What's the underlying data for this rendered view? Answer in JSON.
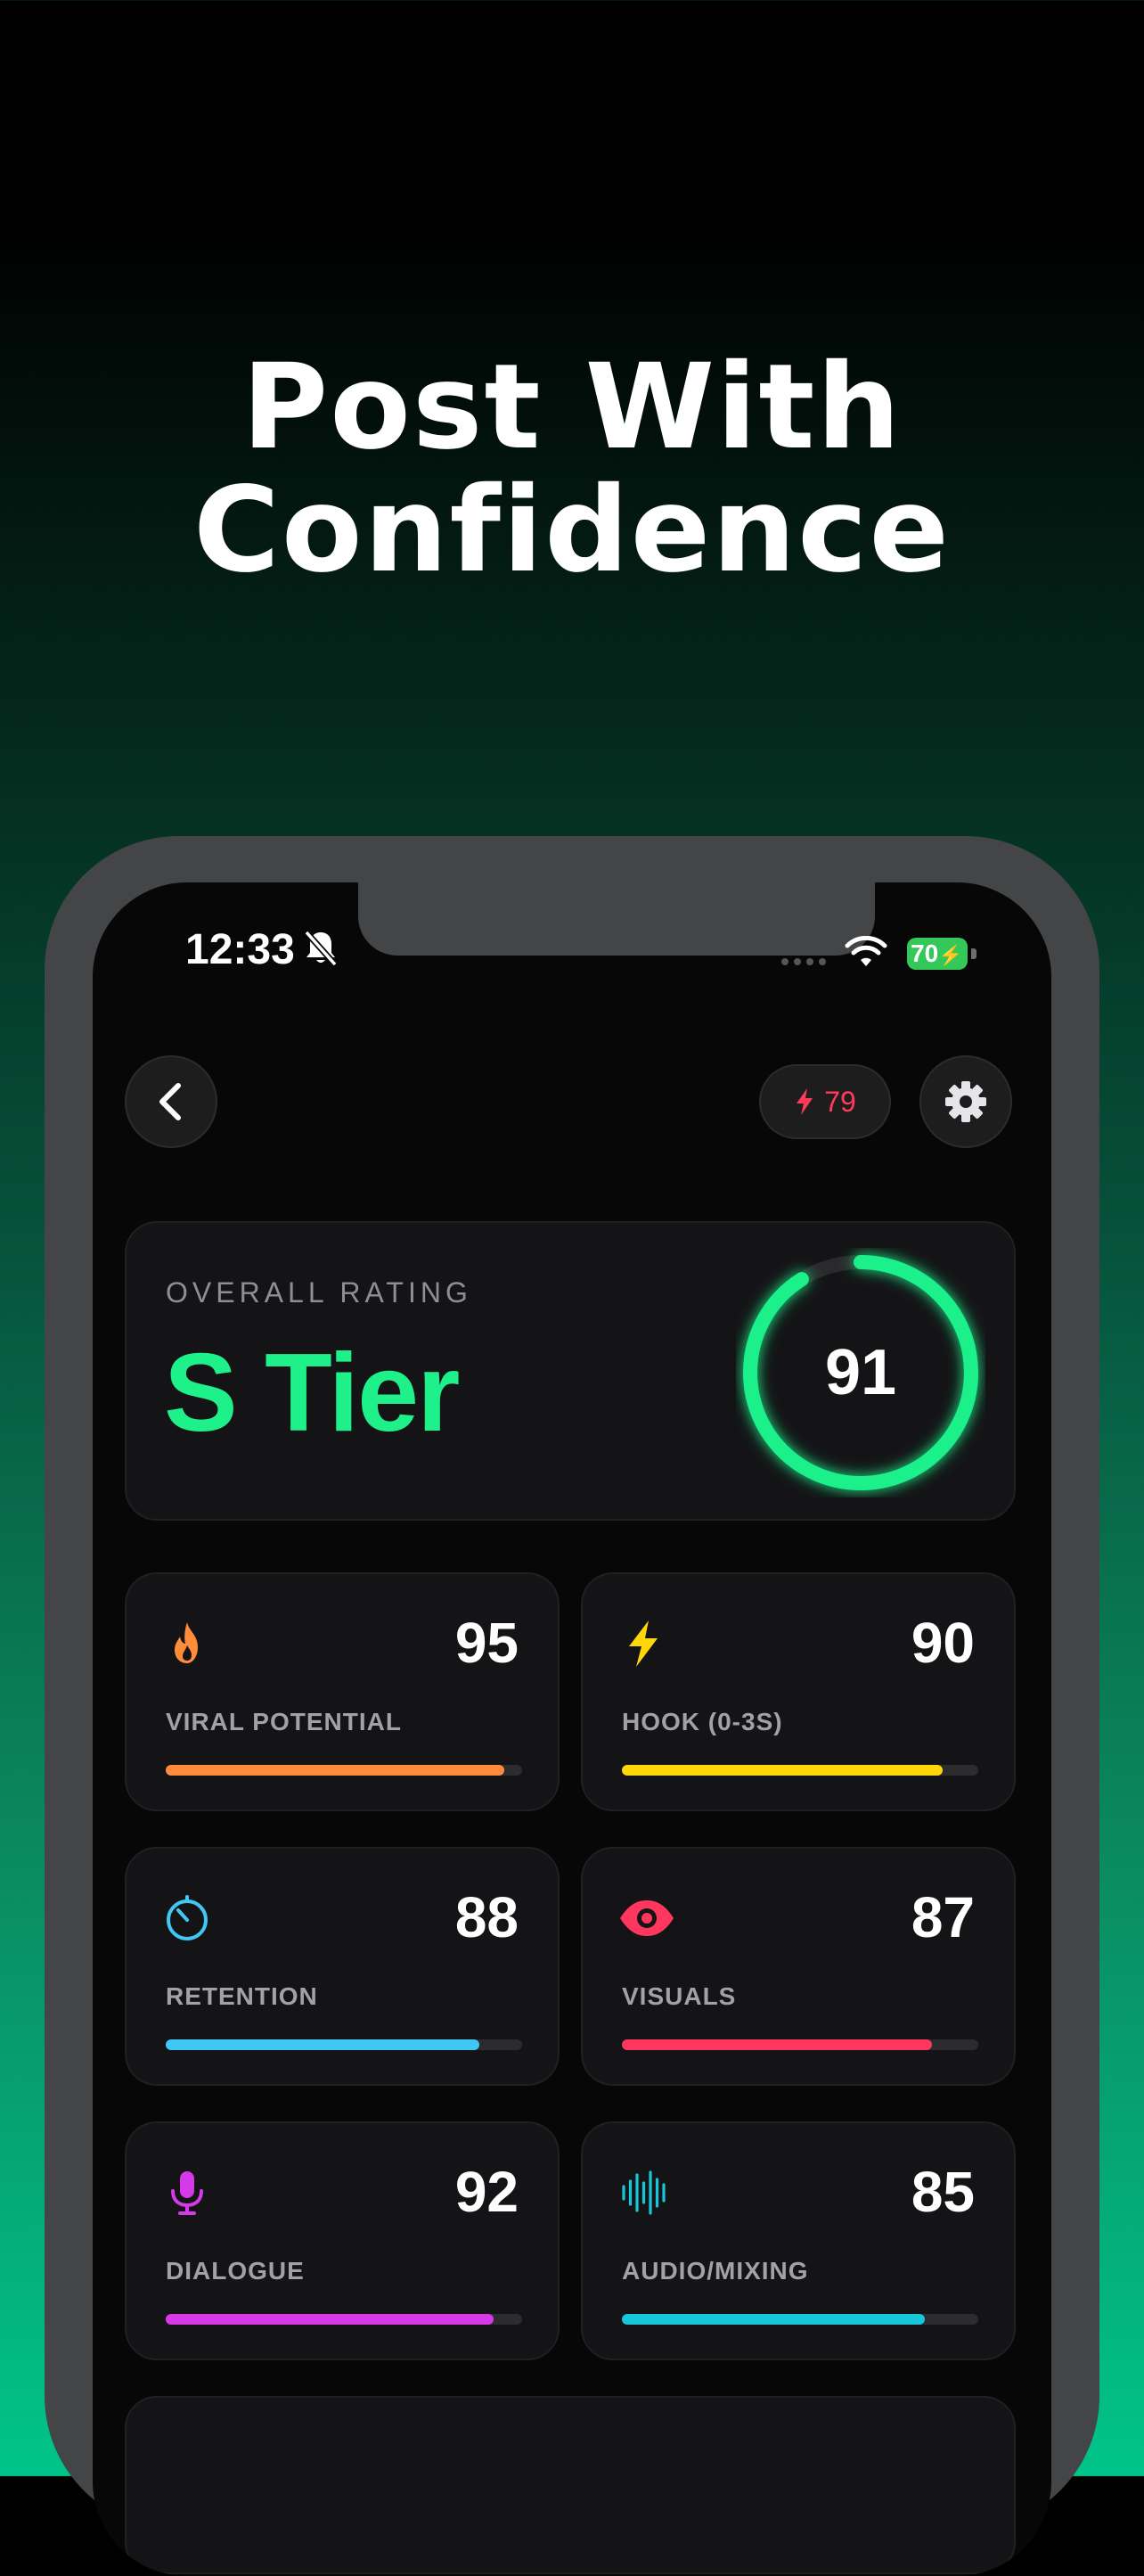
{
  "headline": {
    "line1": "Post With",
    "line2": "Confidence"
  },
  "status_bar": {
    "time": "12:33",
    "battery": "70"
  },
  "header": {
    "credits": "79"
  },
  "overall": {
    "label": "OVERALL RATING",
    "tier": "S Tier",
    "score": "91",
    "score_value": 91,
    "accent": "#1ef08a"
  },
  "metrics": [
    {
      "label": "VIRAL POTENTIAL",
      "value": "95",
      "level": 95,
      "color": "#ff8c3a",
      "icon": "flame-icon"
    },
    {
      "label": "HOOK (0-3S)",
      "value": "90",
      "level": 90,
      "color": "#ffd60a",
      "icon": "bolt-icon"
    },
    {
      "label": "RETENTION",
      "value": "88",
      "level": 88,
      "color": "#40c8f4",
      "icon": "timer-icon"
    },
    {
      "label": "VISUALS",
      "value": "87",
      "level": 87,
      "color": "#ff375f",
      "icon": "eye-icon"
    },
    {
      "label": "DIALOGUE",
      "value": "92",
      "level": 92,
      "color": "#d63ae8",
      "icon": "mic-icon"
    },
    {
      "label": "AUDIO/MIXING",
      "value": "85",
      "level": 85,
      "color": "#17c6d8",
      "icon": "waveform-icon"
    }
  ]
}
